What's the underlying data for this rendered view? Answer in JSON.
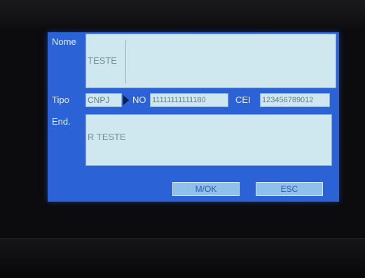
{
  "form": {
    "nome_label": "Nome",
    "nome_value": "TESTE",
    "tipo_label": "Tipo",
    "tipo_value": "CNPJ",
    "no_label": "NO",
    "no_value": "11111111111180",
    "cei_label": "CEI",
    "cei_value": "123456789012",
    "end_label": "End.",
    "end_value": "R TESTE"
  },
  "buttons": {
    "ok_label": "M/OK",
    "esc_label": "ESC"
  },
  "icons": {
    "tipo_selector": "triangle-right-icon"
  },
  "colors": {
    "panel": "#2b63d6",
    "field": "#cfe8ef",
    "button": "#8fc0ec"
  }
}
